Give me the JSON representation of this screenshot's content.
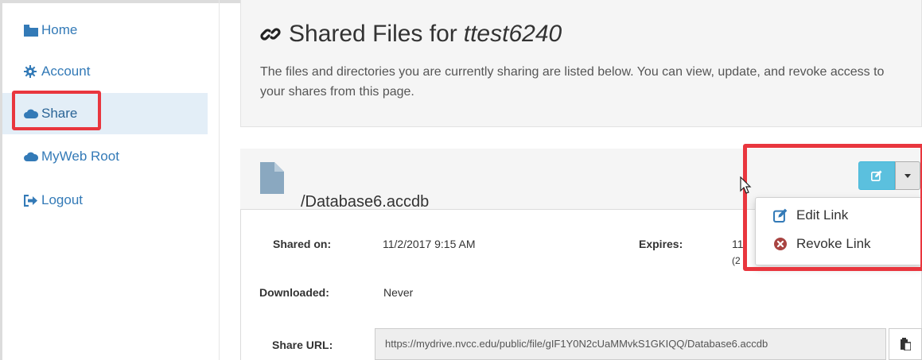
{
  "sidebar": {
    "items": [
      {
        "label": "Home",
        "icon": "folder-icon"
      },
      {
        "label": "Account",
        "icon": "gear-icon"
      },
      {
        "label": "Share",
        "icon": "cloud-icon",
        "active": true
      },
      {
        "label": "MyWeb Root",
        "icon": "cloud-icon"
      },
      {
        "label": "Logout",
        "icon": "sign-out-icon"
      }
    ]
  },
  "header": {
    "title": "Shared Files for",
    "username": "ttest6240",
    "description": "The files and directories you are currently sharing are listed below. You can view, update, and revoke access to your shares from this page."
  },
  "share": {
    "file_name": "/Database6.accdb",
    "shared_on_label": "Shared on:",
    "shared_on_value": "11/2/2017 9:15 AM",
    "expires_label": "Expires:",
    "expires_value_partial": "11",
    "expires_value_partial2": "(2",
    "downloaded_label": "Downloaded:",
    "downloaded_value": "Never",
    "share_url_label": "Share URL:",
    "share_url_value": "https://mydrive.nvcc.edu/public/file/gIF1Y0N2cUaMMvkS1GKIQQ/Database6.accdb"
  },
  "dropdown": {
    "items": [
      {
        "label": "Edit Link",
        "icon": "edit-icon"
      },
      {
        "label": "Revoke Link",
        "icon": "remove-circle-icon"
      }
    ]
  },
  "colors": {
    "link": "#337ab7",
    "highlight": "#e9363e",
    "info_button": "#5bc0de",
    "revoke_icon": "#a94442"
  }
}
